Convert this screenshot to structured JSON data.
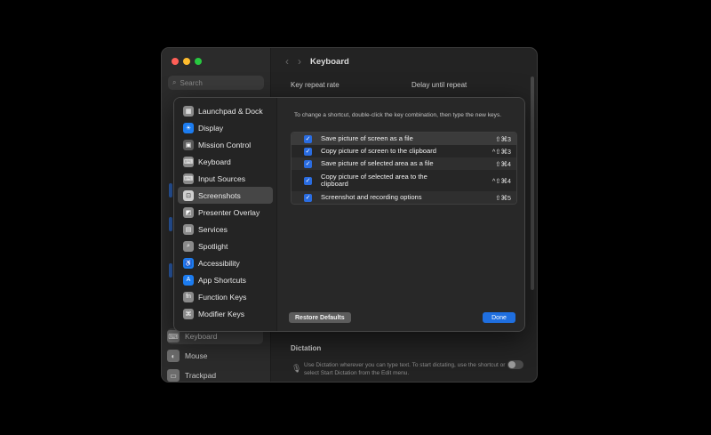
{
  "window": {
    "title": "Keyboard",
    "search_placeholder": "Search",
    "section_key_repeat": "Key repeat rate",
    "section_delay": "Delay until repeat",
    "section_dictation": "Dictation",
    "dictation_desc": "Use Dictation wherever you can type text. To start dictating, use the shortcut or select Start Dictation from the Edit menu.",
    "sidebar_bottom": [
      {
        "label": "Keyboard",
        "icon": "keyboard-icon",
        "glyph": "⌨"
      },
      {
        "label": "Mouse",
        "icon": "mouse-icon",
        "glyph": "◐"
      },
      {
        "label": "Trackpad",
        "icon": "trackpad-icon",
        "glyph": "▭"
      }
    ]
  },
  "sheet": {
    "categories": [
      {
        "label": "Launchpad & Dock",
        "icon": "launchpad-icon",
        "glyph": "▦"
      },
      {
        "label": "Display",
        "icon": "display-icon",
        "glyph": "☀"
      },
      {
        "label": "Mission Control",
        "icon": "mission-control-icon",
        "glyph": "▣"
      },
      {
        "label": "Keyboard",
        "icon": "keyboard-icon",
        "glyph": "⌨"
      },
      {
        "label": "Input Sources",
        "icon": "input-sources-icon",
        "glyph": "⌨"
      },
      {
        "label": "Screenshots",
        "icon": "screenshot-icon",
        "glyph": "⊡"
      },
      {
        "label": "Presenter Overlay",
        "icon": "presenter-overlay-icon",
        "glyph": "◩"
      },
      {
        "label": "Services",
        "icon": "services-icon",
        "glyph": "▤"
      },
      {
        "label": "Spotlight",
        "icon": "spotlight-icon",
        "glyph": "⌕"
      },
      {
        "label": "Accessibility",
        "icon": "accessibility-icon",
        "glyph": "♿"
      },
      {
        "label": "App Shortcuts",
        "icon": "app-shortcuts-icon",
        "glyph": "A"
      },
      {
        "label": "Function Keys",
        "icon": "function-keys-icon",
        "glyph": "fn"
      },
      {
        "label": "Modifier Keys",
        "icon": "modifier-keys-icon",
        "glyph": "⌘"
      }
    ],
    "selected_index": 5,
    "hint": "To change a shortcut, double-click the key combination, then type the new keys.",
    "shortcuts": [
      {
        "label": "Save picture of screen as a file",
        "keys": "⇧⌘3",
        "checked": true
      },
      {
        "label": "Copy picture of screen to the clipboard",
        "keys": "^⇧⌘3",
        "checked": true
      },
      {
        "label": "Save picture of selected area as a file",
        "keys": "⇧⌘4",
        "checked": true
      },
      {
        "label": "Copy picture of selected area to the clipboard",
        "keys": "^⇧⌘4",
        "checked": true
      },
      {
        "label": "Screenshot and recording options",
        "keys": "⇧⌘5",
        "checked": true
      }
    ],
    "restore_label": "Restore Defaults",
    "done_label": "Done"
  },
  "colors": {
    "accent": "#1f6fe0",
    "checkbox": "#2a6ce0",
    "window_bg": "#232323",
    "sheet_bg": "#2a2a2a"
  }
}
